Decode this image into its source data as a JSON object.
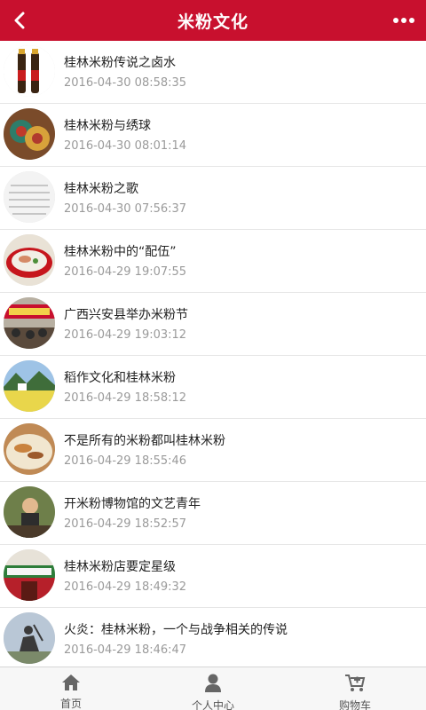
{
  "header": {
    "title": "米粉文化",
    "back_icon": "chevron-left-icon",
    "more_icon": "more-dots-icon",
    "color": "#c8102e"
  },
  "articles": [
    {
      "title": "桂林米粉传说之卤水",
      "date": "2016-04-30 08:58:35"
    },
    {
      "title": "桂林米粉与绣球",
      "date": "2016-04-30 08:01:14"
    },
    {
      "title": "桂林米粉之歌",
      "date": "2016-04-30 07:56:37"
    },
    {
      "title": "桂林米粉中的“配伍”",
      "date": "2016-04-29 19:07:55"
    },
    {
      "title": "广西兴安县举办米粉节",
      "date": "2016-04-29 19:03:12"
    },
    {
      "title": "稻作文化和桂林米粉",
      "date": "2016-04-29 18:58:12"
    },
    {
      "title": "不是所有的米粉都叫桂林米粉",
      "date": "2016-04-29 18:55:46"
    },
    {
      "title": "开米粉博物馆的文艺青年",
      "date": "2016-04-29 18:52:57"
    },
    {
      "title": "桂林米粉店要定星级",
      "date": "2016-04-29 18:49:32"
    },
    {
      "title": "火炎：桂林米粉，一个与战争相关的传说",
      "date": "2016-04-29 18:46:47"
    }
  ],
  "tabbar": {
    "home_label": "首页",
    "home_icon": "home-icon",
    "profile_label": "个人中心",
    "profile_icon": "user-icon",
    "cart_label": "购物车",
    "cart_icon": "cart-icon"
  }
}
